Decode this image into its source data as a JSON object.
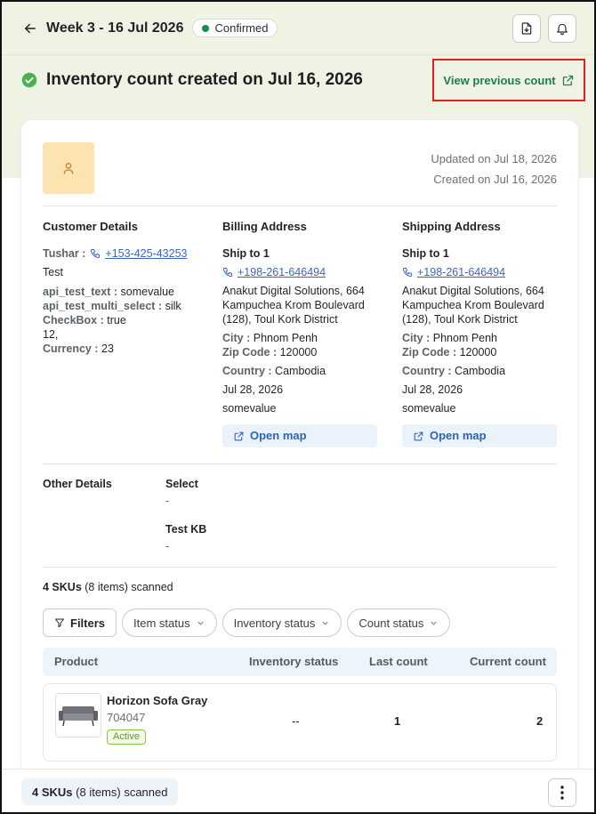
{
  "header": {
    "title": "Week 3 - 16 Jul 2026",
    "status": "Confirmed",
    "status_color": "#1f8a4c"
  },
  "banner": {
    "title": "Inventory count created on Jul 16, 2026",
    "view_previous": "View previous count"
  },
  "card": {
    "updated": "Updated on Jul 18, 2026",
    "created": "Created on Jul 16, 2026",
    "customer": {
      "heading": "Customer Details",
      "name": "Tushar :",
      "phone": "+153-425-43253",
      "note": "Test",
      "fields": [
        {
          "key": "api_test_text :",
          "value": "somevalue"
        },
        {
          "key": "api_test_multi_select :",
          "value": "silk"
        },
        {
          "key": "CheckBox :",
          "value": "true"
        }
      ],
      "extra": "12,",
      "currency_key": "Currency :",
      "currency_value": "23"
    },
    "billing": {
      "heading": "Billing Address",
      "ship_to": "Ship to 1",
      "phone": "+198-261-646494",
      "address": "Anakut Digital Solutions, 664 Kampuchea Krom Boulevard (128), Toul Kork District",
      "city_key": "City :",
      "city": "Phnom Penh",
      "zip_key": "Zip Code :",
      "zip": "120000",
      "country_key": "Country :",
      "country": "Cambodia",
      "date": "Jul 28, 2026",
      "custom": "somevalue",
      "open_map": "Open map"
    },
    "shipping": {
      "heading": "Shipping Address",
      "ship_to": "Ship to 1",
      "phone": "+198-261-646494",
      "address": "Anakut Digital Solutions, 664 Kampuchea Krom Boulevard (128), Toul Kork District",
      "city_key": "City :",
      "city": "Phnom Penh",
      "zip_key": "Zip Code :",
      "zip": "120000",
      "country_key": "Country :",
      "country": "Cambodia",
      "date": "Jul 28, 2026",
      "custom": "somevalue",
      "open_map": "Open map"
    },
    "other": {
      "heading": "Other Details",
      "fields": [
        {
          "label": "Select",
          "value": "-"
        },
        {
          "label": "Test KB",
          "value": "-"
        }
      ]
    },
    "skus": {
      "count": "4 SKUs",
      "rest": "(8 items) scanned"
    },
    "filters": [
      "Filters",
      "Item status",
      "Inventory status",
      "Count status"
    ],
    "table": {
      "columns": [
        "Product",
        "Inventory status",
        "Last count",
        "Current count"
      ],
      "rows": [
        {
          "name": "Horizon Sofa Gray",
          "code": "704047",
          "badge": "Active",
          "inventory_status": "--",
          "last_count": "1",
          "current_count": "2"
        }
      ]
    }
  },
  "footer": {
    "count": "4 SKUs",
    "rest": "(8 items) scanned"
  }
}
